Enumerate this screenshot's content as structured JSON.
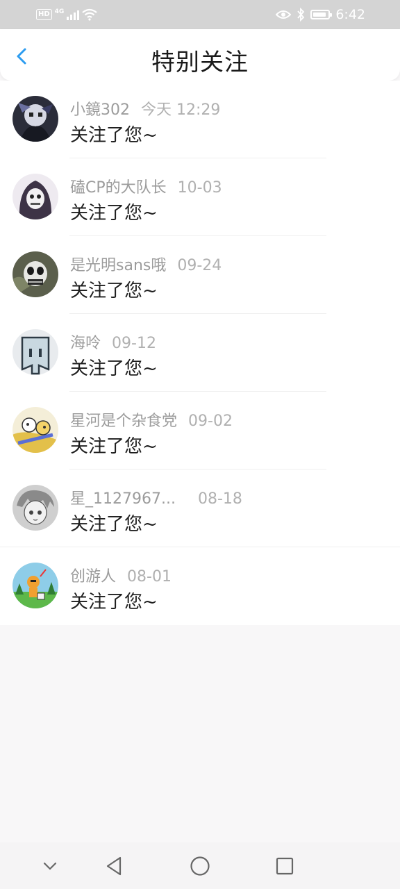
{
  "status_bar": {
    "hd": "HD",
    "network": "4G",
    "time": "6:42"
  },
  "header": {
    "title": "特别关注"
  },
  "items": [
    {
      "name": "小鏡302",
      "date": "今天 12:29",
      "message": "关注了您~",
      "avatar_icon": "dark-character-avatar"
    },
    {
      "name": "磕CP的大队长",
      "date": "10-03",
      "message": "关注了您~",
      "avatar_icon": "hooded-skeleton-avatar"
    },
    {
      "name": "是光明sans哦",
      "date": "09-24",
      "message": "关注了您~",
      "avatar_icon": "skull-avatar"
    },
    {
      "name": "海呤",
      "date": "09-12",
      "message": "关注了您~",
      "avatar_icon": "box-face-avatar"
    },
    {
      "name": "星河是个杂食党",
      "date": "09-02",
      "message": "关注了您~",
      "avatar_icon": "colorful-character-avatar"
    },
    {
      "name": "星_1127967...",
      "date": "08-18",
      "message": "关注了您~",
      "avatar_icon": "sketch-character-avatar"
    },
    {
      "name": "创游人",
      "date": "08-01",
      "message": "关注了您~",
      "avatar_icon": "pixel-game-avatar"
    }
  ],
  "colors": {
    "accent": "#2c9cf0",
    "status_bar_bg": "#d4d4d4",
    "page_bg": "#f8f7f8"
  },
  "nav": {
    "icons": [
      "chevron-down-icon",
      "back-triangle-icon",
      "home-circle-icon",
      "recents-square-icon"
    ]
  }
}
